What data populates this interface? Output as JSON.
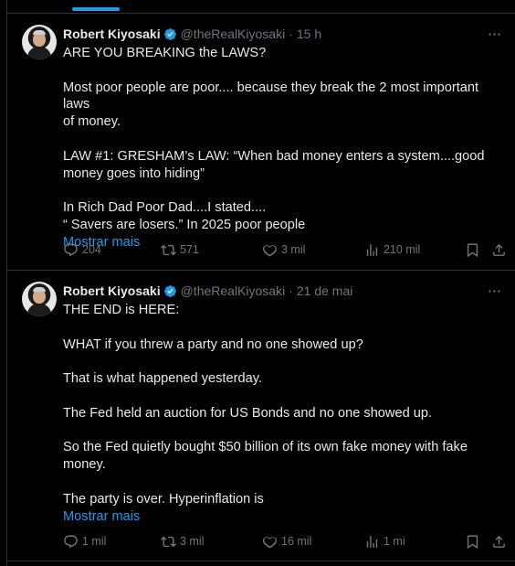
{
  "tweets": [
    {
      "author_name": "Robert Kiyosaki",
      "handle": "@theRealKiyosaki",
      "separator": "·",
      "time": "15 h",
      "lines": [
        "ARE YOU BREAKING the LAWS?",
        "",
        "Most poor people are poor.... because they break the 2 most important laws",
        "of money.",
        "",
        "LAW #1:  GRESHAM’s LAW:  “When bad money enters a system....good",
        "money goes into hiding”",
        "",
        "In Rich Dad Poor Dad....I stated....",
        "“ Savers are losers.”  In 2025 poor people"
      ],
      "show_more": "Mostrar mais",
      "replies": "204",
      "reposts": "571",
      "likes": "3 mil",
      "views": "210 mil"
    },
    {
      "author_name": "Robert Kiyosaki",
      "handle": "@theRealKiyosaki",
      "separator": "·",
      "time": "21 de mai",
      "lines": [
        "THE END is HERE:",
        "",
        "WHAT if you threw a party and no one showed up?",
        "",
        "That is what happened yesterday.",
        "",
        "The Fed held an auction for US Bonds and no one showed up.",
        "",
        "So the Fed quietly bought $50 billion of its own fake money with fake",
        "money.",
        "",
        "The party is over.  Hyperinflation is"
      ],
      "show_more": "Mostrar mais",
      "replies": "1 mil",
      "reposts": "3 mil",
      "likes": "16 mil",
      "views": "1 mi"
    }
  ],
  "icons": {
    "verified": "verified-badge-icon",
    "more": "more-dots-icon",
    "reply": "reply-bubble-icon",
    "repost": "repost-arrows-icon",
    "like": "heart-icon",
    "views": "analytics-bars-icon",
    "bookmark": "bookmark-icon",
    "share": "share-upload-icon"
  },
  "colors": {
    "background": "#000000",
    "text": "#e7e9ea",
    "muted": "#71767b",
    "accent": "#1d9bf0",
    "border": "#2f3336"
  }
}
